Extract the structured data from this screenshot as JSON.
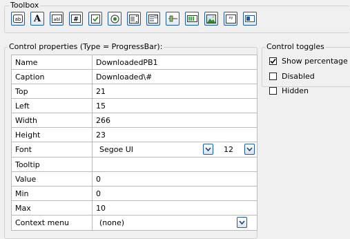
{
  "toolbox": {
    "title": "Toolbox",
    "tools": [
      {
        "name": "button-tool",
        "glyph": "ab"
      },
      {
        "name": "label-tool",
        "glyph": "A"
      },
      {
        "name": "textbox-tool",
        "glyph": "abl"
      },
      {
        "name": "numeric-tool",
        "glyph": "#"
      },
      {
        "name": "checkbox-tool",
        "glyph": "✓"
      },
      {
        "name": "radio-tool",
        "glyph": "◉"
      },
      {
        "name": "list-tool",
        "glyph": "≡"
      },
      {
        "name": "combo-tool",
        "glyph": "≡"
      },
      {
        "name": "slider-tool",
        "glyph": "▭"
      },
      {
        "name": "progressbar-tool",
        "glyph": "▮"
      },
      {
        "name": "picture-tool",
        "glyph": "▲"
      },
      {
        "name": "graph-tool",
        "glyph": "xy"
      },
      {
        "name": "toggle-tool",
        "glyph": "◼"
      }
    ]
  },
  "properties": {
    "title": "Control properties (Type = ProgressBar):",
    "rows": [
      {
        "label": "Name",
        "value": "DownloadedPB1"
      },
      {
        "label": "Caption",
        "value": "Downloaded\\#"
      },
      {
        "label": "Top",
        "value": "21"
      },
      {
        "label": "Left",
        "value": "15"
      },
      {
        "label": "Width",
        "value": "266"
      },
      {
        "label": "Height",
        "value": "23"
      },
      {
        "label": "Font",
        "font_name": "Segoe UI",
        "font_size": "12"
      },
      {
        "label": "Tooltip",
        "value": ""
      },
      {
        "label": "Value",
        "value": "0"
      },
      {
        "label": "Min",
        "value": "0"
      },
      {
        "label": "Max",
        "value": "10"
      },
      {
        "label": "Context menu",
        "selected": "(none)"
      }
    ]
  },
  "toggles": {
    "title": "Control toggles",
    "items": [
      {
        "label": "Show percentage",
        "checked": true
      },
      {
        "label": "Disabled",
        "checked": false
      },
      {
        "label": "Hidden",
        "checked": false
      }
    ]
  },
  "colors": {
    "accent_border": "#1c5aa6",
    "group_border": "#d0d0d0",
    "grid_border": "#b9b9b9"
  }
}
